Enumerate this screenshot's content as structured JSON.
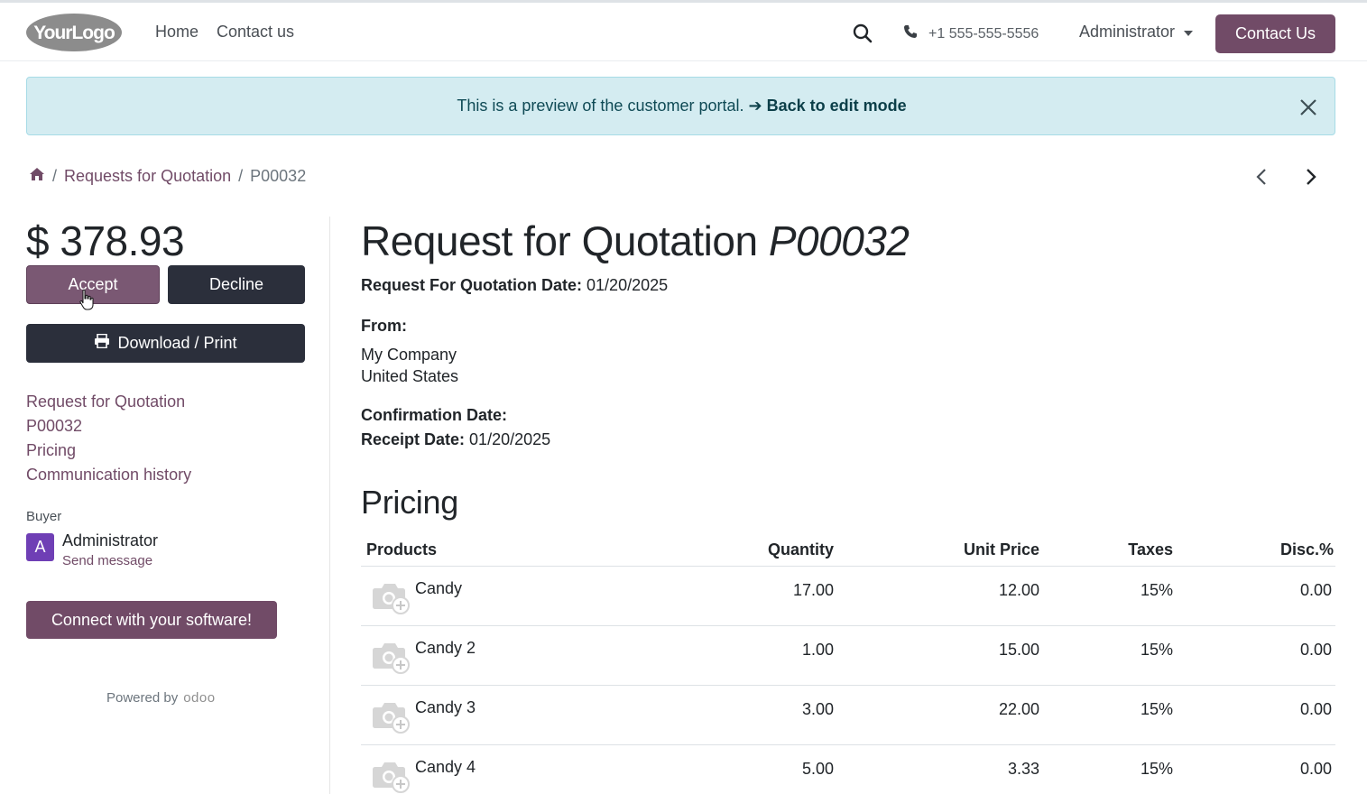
{
  "header": {
    "logo_text": "YourLogo",
    "nav": [
      {
        "label": "Home"
      },
      {
        "label": "Contact us"
      }
    ],
    "phone": "+1 555-555-5556",
    "user": "Administrator",
    "contact_button": "Contact Us",
    "icons": [
      "search-icon",
      "phone-icon",
      "chevron-down-icon"
    ]
  },
  "banner": {
    "text": "This is a preview of the customer portal.",
    "link": "➔ Back to edit mode"
  },
  "breadcrumb": {
    "items": [
      "Requests for Quotation",
      "P00032"
    ],
    "separator": "/"
  },
  "sidebar": {
    "amount": "$ 378.93",
    "accept_label": "Accept",
    "decline_label": "Decline",
    "download_label": "Download / Print",
    "toc": [
      "Request for Quotation",
      "P00032",
      "Pricing",
      "Communication history"
    ],
    "buyer_label": "Buyer",
    "buyer_initial": "A",
    "buyer_name": "Administrator",
    "send_message": "Send message",
    "connect_label": "Connect with your software!",
    "powered_by": "Powered by",
    "powered_brand": "odoo"
  },
  "document": {
    "title_prefix": "Request for Quotation",
    "title_ref": "P00032",
    "rfq_date_label": "Request For Quotation Date:",
    "rfq_date": "01/20/2025",
    "from_label": "From:",
    "from_company": "My Company",
    "from_country": "United States",
    "confirmation_label": "Confirmation Date:",
    "receipt_label": "Receipt Date:",
    "receipt_date": "01/20/2025"
  },
  "pricing": {
    "title": "Pricing",
    "columns": [
      "Products",
      "Quantity",
      "Unit Price",
      "Taxes",
      "Disc.%"
    ],
    "rows": [
      {
        "product": "Candy",
        "quantity": "17.00",
        "unit_price": "12.00",
        "taxes": "15%",
        "discount": "0.00"
      },
      {
        "product": "Candy 2",
        "quantity": "1.00",
        "unit_price": "15.00",
        "taxes": "15%",
        "discount": "0.00"
      },
      {
        "product": "Candy 3",
        "quantity": "3.00",
        "unit_price": "22.00",
        "taxes": "15%",
        "discount": "0.00"
      },
      {
        "product": "Candy 4",
        "quantity": "5.00",
        "unit_price": "3.33",
        "taxes": "15%",
        "discount": "0.00"
      }
    ]
  },
  "colors": {
    "brand": "#714b67",
    "dark_button": "#2b2f3b",
    "banner_bg": "#d4ecf1",
    "avatar": "#6f3fb5"
  }
}
